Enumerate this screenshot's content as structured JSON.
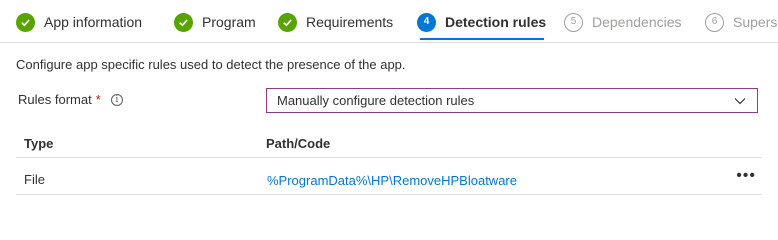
{
  "steps": [
    {
      "label": "App information",
      "state": "done"
    },
    {
      "label": "Program",
      "state": "done"
    },
    {
      "label": "Requirements",
      "state": "done"
    },
    {
      "label": "Detection rules",
      "state": "active",
      "number": "4"
    },
    {
      "label": "Dependencies",
      "state": "pending",
      "number": "5"
    },
    {
      "label": "Supersedence",
      "state": "pending",
      "number": "6"
    }
  ],
  "description": "Configure app specific rules used to detect the presence of the app.",
  "rules_format": {
    "label": "Rules format",
    "required_marker": "*",
    "info_icon": "info-icon",
    "selected_value": "Manually configure detection rules"
  },
  "table": {
    "headers": {
      "type": "Type",
      "path": "Path/Code"
    },
    "rows": [
      {
        "type": "File",
        "path": "%ProgramData%\\HP\\RemoveHPBloatware",
        "action": "more-icon"
      }
    ]
  },
  "colors": {
    "done": "#57a300",
    "active": "#0078d4",
    "link": "#0078d4",
    "required": "#a4262c",
    "select_border": "#8a3c8a"
  }
}
